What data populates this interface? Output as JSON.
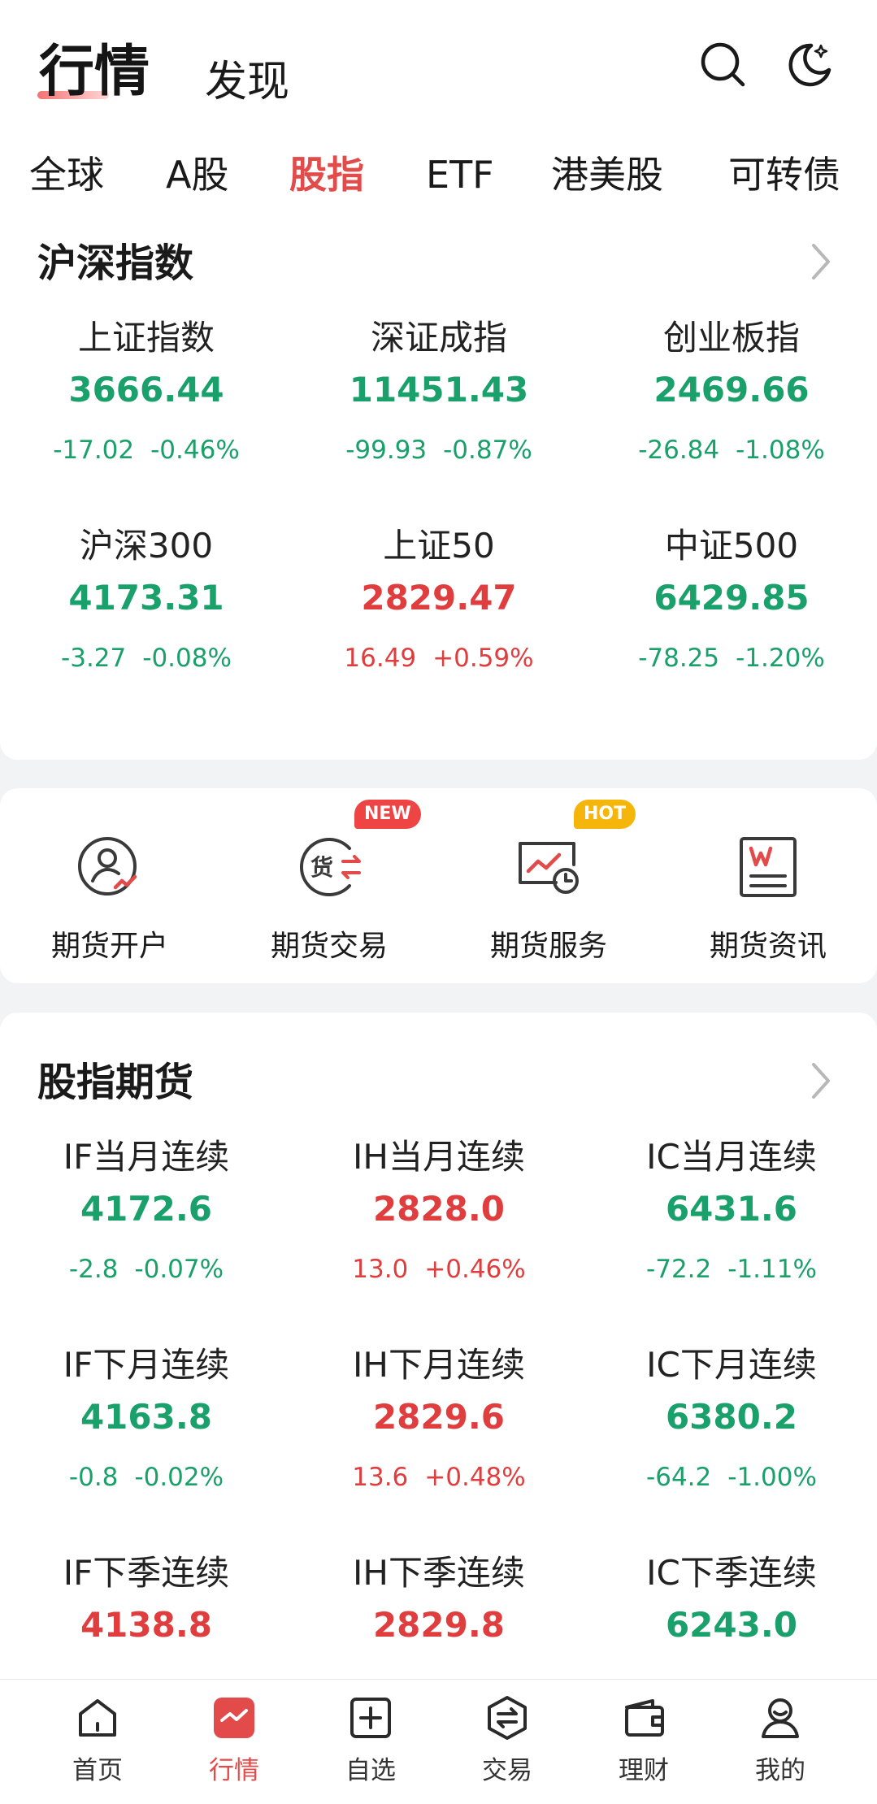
{
  "header": {
    "title": "行情",
    "subtitle": "发现",
    "search_icon": "search-icon",
    "theme_icon": "moon-icon"
  },
  "tabs": [
    {
      "label": "全球"
    },
    {
      "label": "A股"
    },
    {
      "label": "股指",
      "active": true
    },
    {
      "label": "ETF"
    },
    {
      "label": "港美股"
    },
    {
      "label": "可转债"
    }
  ],
  "indices": {
    "title": "沪深指数",
    "items": [
      {
        "name": "上证指数",
        "price": "3666.44",
        "change": "-17.02",
        "pct": "-0.46%",
        "trend": "down"
      },
      {
        "name": "深证成指",
        "price": "11451.43",
        "change": "-99.93",
        "pct": "-0.87%",
        "trend": "down"
      },
      {
        "name": "创业板指",
        "price": "2469.66",
        "change": "-26.84",
        "pct": "-1.08%",
        "trend": "down"
      },
      {
        "name": "沪深300",
        "price": "4173.31",
        "change": "-3.27",
        "pct": "-0.08%",
        "trend": "down"
      },
      {
        "name": "上证50",
        "price": "2829.47",
        "change": "16.49",
        "pct": "+0.59%",
        "trend": "up"
      },
      {
        "name": "中证500",
        "price": "6429.85",
        "change": "-78.25",
        "pct": "-1.20%",
        "trend": "down"
      }
    ]
  },
  "features": [
    {
      "label": "期货开户",
      "icon": "account-open-icon"
    },
    {
      "label": "期货交易",
      "icon": "futures-trade-icon",
      "badge": "NEW"
    },
    {
      "label": "期货服务",
      "icon": "futures-service-icon",
      "badge": "HOT"
    },
    {
      "label": "期货资讯",
      "icon": "futures-news-icon"
    }
  ],
  "futures": {
    "title": "股指期货",
    "items": [
      {
        "name": "IF当月连续",
        "price": "4172.6",
        "change": "-2.8",
        "pct": "-0.07%",
        "trend": "down"
      },
      {
        "name": "IH当月连续",
        "price": "2828.0",
        "change": "13.0",
        "pct": "+0.46%",
        "trend": "up"
      },
      {
        "name": "IC当月连续",
        "price": "6431.6",
        "change": "-72.2",
        "pct": "-1.11%",
        "trend": "down"
      },
      {
        "name": "IF下月连续",
        "price": "4163.8",
        "change": "-0.8",
        "pct": "-0.02%",
        "trend": "down"
      },
      {
        "name": "IH下月连续",
        "price": "2829.6",
        "change": "13.6",
        "pct": "+0.48%",
        "trend": "up"
      },
      {
        "name": "IC下月连续",
        "price": "6380.2",
        "change": "-64.2",
        "pct": "-1.00%",
        "trend": "down"
      },
      {
        "name": "IF下季连续",
        "price": "4138.8",
        "trend": "up"
      },
      {
        "name": "IH下季连续",
        "price": "2829.8",
        "trend": "up"
      },
      {
        "name": "IC下季连续",
        "price": "6243.0",
        "trend": "down"
      }
    ]
  },
  "bottom_nav": [
    {
      "label": "首页",
      "icon": "home-icon"
    },
    {
      "label": "行情",
      "icon": "market-icon",
      "active": true
    },
    {
      "label": "自选",
      "icon": "watchlist-add-icon"
    },
    {
      "label": "交易",
      "icon": "trade-icon"
    },
    {
      "label": "理财",
      "icon": "wallet-icon"
    },
    {
      "label": "我的",
      "icon": "profile-icon"
    }
  ],
  "colors": {
    "up": "#e03e3e",
    "down": "#1aa06a",
    "accent": "#e34a4a"
  }
}
